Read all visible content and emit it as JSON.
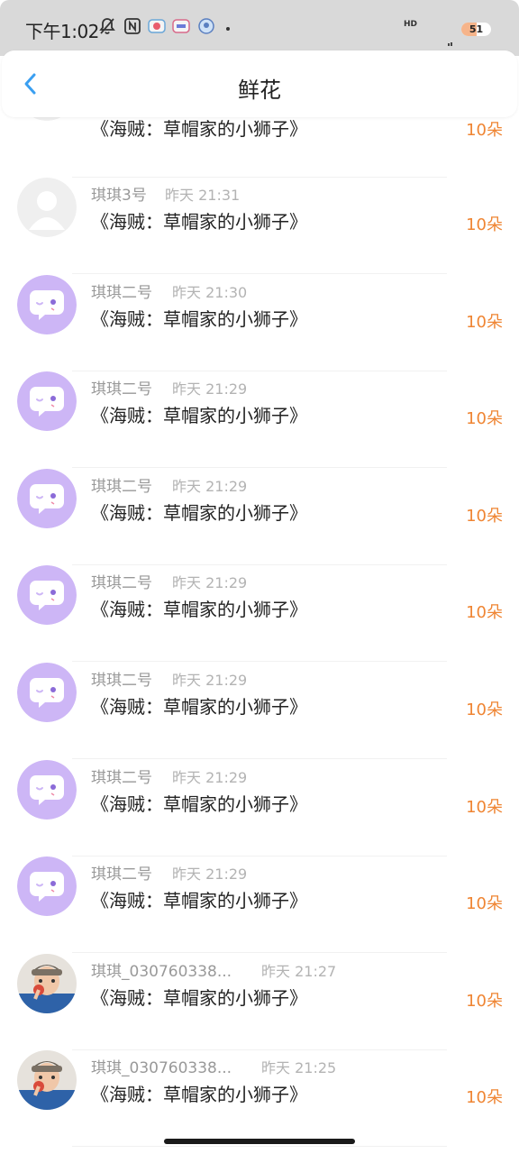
{
  "status_bar": {
    "time": "下午1:02",
    "hd": "HD",
    "battery_level": "51",
    "battery_fraction": 0.51
  },
  "nav": {
    "title": "鲜花",
    "back_icon": "chevron-left-icon"
  },
  "colors": {
    "accent": "#ef8533",
    "back": "#3a9ff1",
    "avatar_purple": "#cdb6f6"
  },
  "items": [
    {
      "name": "",
      "time": "",
      "title": "《海贼：草帽家的小狮子》",
      "count": "10朵",
      "avatar": "default-avatar"
    },
    {
      "name": "琪琪3号",
      "time": "昨天 21:31",
      "title": "《海贼：草帽家的小狮子》",
      "count": "10朵",
      "avatar": "default-avatar"
    },
    {
      "name": "琪琪二号",
      "time": "昨天 21:30",
      "title": "《海贼：草帽家的小狮子》",
      "count": "10朵",
      "avatar": "chat-bubble-avatar"
    },
    {
      "name": "琪琪二号",
      "time": "昨天 21:29",
      "title": "《海贼：草帽家的小狮子》",
      "count": "10朵",
      "avatar": "chat-bubble-avatar"
    },
    {
      "name": "琪琪二号",
      "time": "昨天 21:29",
      "title": "《海贼：草帽家的小狮子》",
      "count": "10朵",
      "avatar": "chat-bubble-avatar"
    },
    {
      "name": "琪琪二号",
      "time": "昨天 21:29",
      "title": "《海贼：草帽家的小狮子》",
      "count": "10朵",
      "avatar": "chat-bubble-avatar"
    },
    {
      "name": "琪琪二号",
      "time": "昨天 21:29",
      "title": "《海贼：草帽家的小狮子》",
      "count": "10朵",
      "avatar": "chat-bubble-avatar"
    },
    {
      "name": "琪琪二号",
      "time": "昨天 21:29",
      "title": "《海贼：草帽家的小狮子》",
      "count": "10朵",
      "avatar": "chat-bubble-avatar"
    },
    {
      "name": "琪琪二号",
      "time": "昨天 21:29",
      "title": "《海贼：草帽家的小狮子》",
      "count": "10朵",
      "avatar": "chat-bubble-avatar"
    },
    {
      "name": "琪琪_030760338...",
      "time": "昨天 21:27",
      "title": "《海贼：草帽家的小狮子》",
      "count": "10朵",
      "avatar": "child-photo-avatar"
    },
    {
      "name": "琪琪_030760338...",
      "time": "昨天 21:25",
      "title": "《海贼：草帽家的小狮子》",
      "count": "10朵",
      "avatar": "child-photo-avatar"
    }
  ]
}
